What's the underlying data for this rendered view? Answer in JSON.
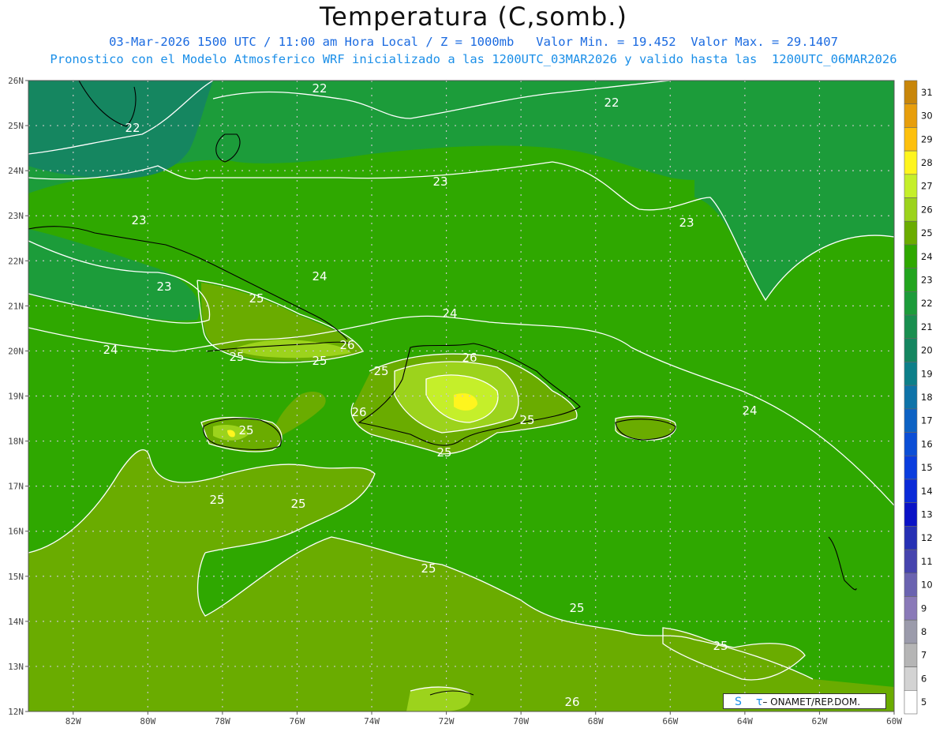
{
  "title": "Temperatura (C,somb.)",
  "info_line1": "03-Mar-2026 1500 UTC / 11:00 am Hora Local / Z = 1000mb   Valor Min. = 19.452  Valor Max. = 29.1407",
  "info_line2": "Pronostico con el Modelo Atmosferico WRF inicializado a las 1200UTC_03MAR2026 y valido hasta las  1200UTC_06MAR2026",
  "lat_labels": [
    "26N",
    "25N",
    "24N",
    "23N",
    "22N",
    "21N",
    "20N",
    "19N",
    "18N",
    "17N",
    "16N",
    "15N",
    "14N",
    "13N",
    "12N"
  ],
  "lon_labels": [
    "82W",
    "80W",
    "78W",
    "76W",
    "74W",
    "72W",
    "70W",
    "68W",
    "66W",
    "64W",
    "62W",
    "60W"
  ],
  "colorbar": {
    "levels": [
      "31",
      "30",
      "29",
      "28",
      "27",
      "26",
      "25",
      "24",
      "23",
      "22",
      "21",
      "20",
      "19",
      "18",
      "17",
      "16",
      "15",
      "14",
      "13",
      "12",
      "11",
      "10",
      "9",
      "8",
      "7",
      "6",
      "5"
    ],
    "colors": [
      "#c8860a",
      "#e79e0c",
      "#fdc00d",
      "#fef51e",
      "#c5ef2a",
      "#9cd31c",
      "#6aac00",
      "#2fa800",
      "#22a51e",
      "#1c9c3a",
      "#198f4f",
      "#158660",
      "#0d7f89",
      "#0e73a8",
      "#0d62c4",
      "#0b4ed6",
      "#0a3dde",
      "#0a2ad8",
      "#0a12c6",
      "#2630b4",
      "#4644ae",
      "#6a63b0",
      "#8a7ab8",
      "#9b9bab",
      "#b5b5b5",
      "#d3d3d3",
      "#ffffff"
    ]
  },
  "contour_labels": [
    "22",
    "22",
    "22",
    "23",
    "23",
    "23",
    "23",
    "24",
    "24",
    "24",
    "24",
    "25",
    "25",
    "25",
    "25",
    "25",
    "25",
    "25",
    "25",
    "25",
    "25",
    "25",
    "25",
    "26",
    "26",
    "26",
    "26"
  ],
  "colors": {
    "sea_base": "#2fa800",
    "cool_22": "#1c9c3a",
    "cool_21": "#158660",
    "warm_25": "#6aac00",
    "warm_26": "#9cd31c",
    "warm_27": "#c5ef2a",
    "hot_28": "#fef51e"
  },
  "credit": {
    "s": "S",
    "tau": "τ",
    "text": "– ONAMET/REP.DOM."
  }
}
